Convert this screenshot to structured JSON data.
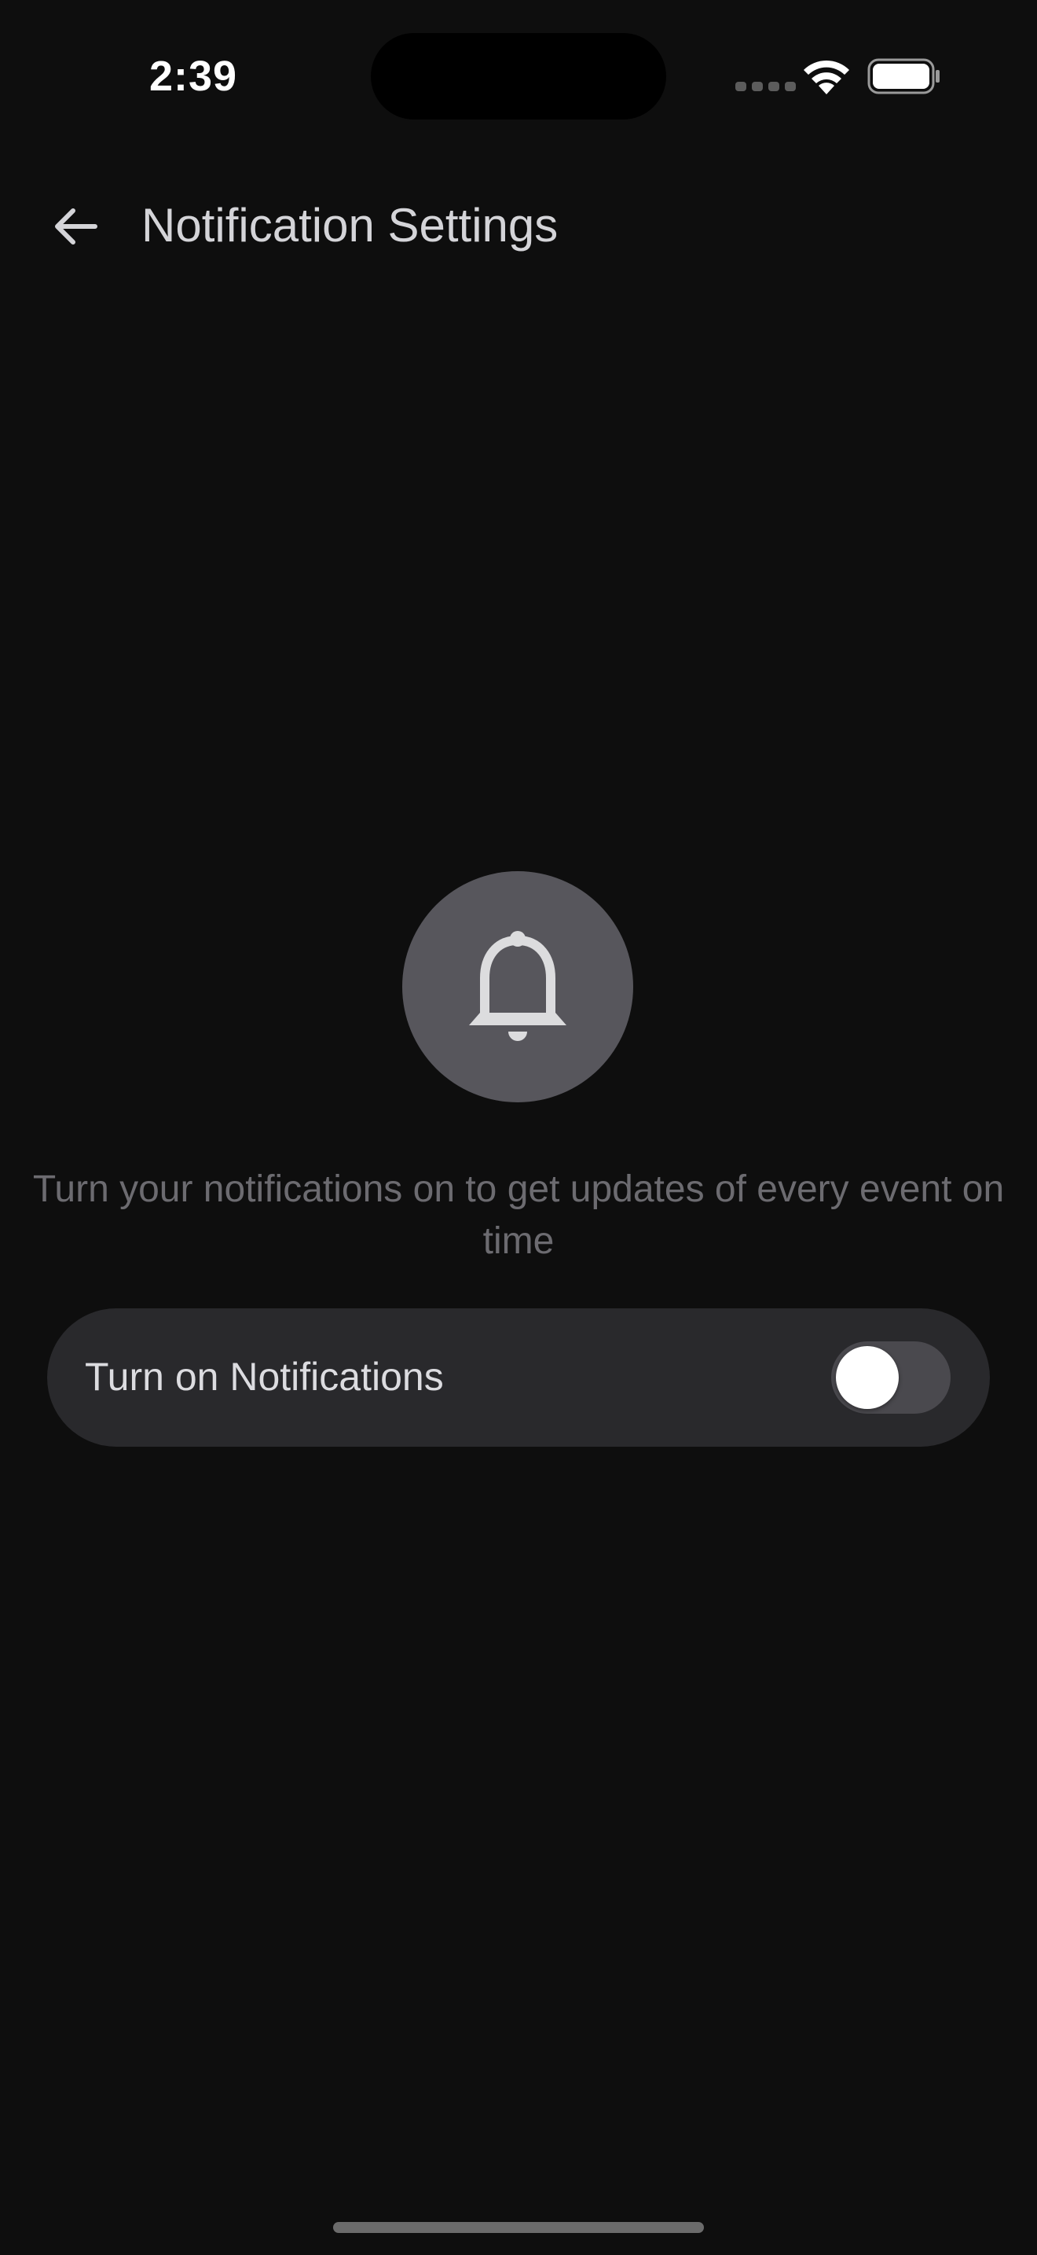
{
  "status_bar": {
    "time": "2:39",
    "icons": [
      "cellular-signal-icon",
      "wifi-icon",
      "battery-icon"
    ]
  },
  "header": {
    "back_icon": "arrow-left-icon",
    "title": "Notification Settings"
  },
  "hero": {
    "icon": "bell-icon",
    "description": "Turn your notifications on to get updates of every event on time"
  },
  "notifications_toggle": {
    "label": "Turn on Notifications",
    "enabled": false
  },
  "colors": {
    "background": "#0e0e0e",
    "card": "#29292c",
    "bell_circle": "#57565c",
    "muted_text": "#6c6b70",
    "switch_track_off": "#4a494e"
  }
}
